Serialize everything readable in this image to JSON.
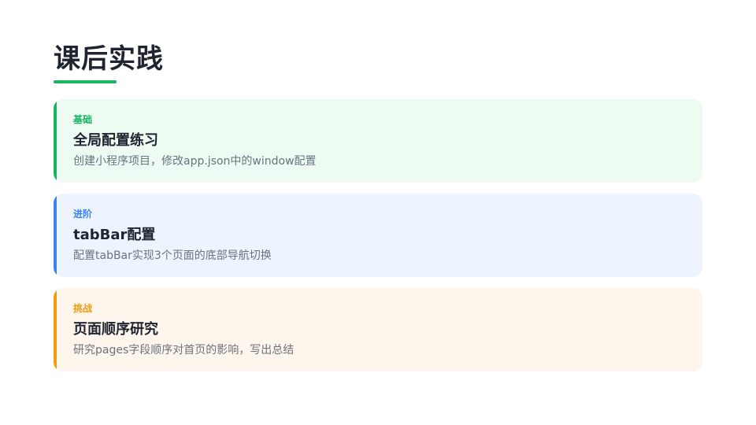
{
  "title": "课后实践",
  "colors": {
    "title_underline": "#18b45f"
  },
  "cards": [
    {
      "level": "基础",
      "title": "全局配置练习",
      "desc": "创建小程序项目，修改app.json中的window配置",
      "accent": "#18b45f",
      "background": "#edfbf2"
    },
    {
      "level": "进阶",
      "title": "tabBar配置",
      "desc": "配置tabBar实现3个页面的底部导航切换",
      "accent": "#3b82f6",
      "background": "#eef4fe"
    },
    {
      "level": "挑战",
      "title": "页面顺序研究",
      "desc": "研究pages字段顺序对首页的影响，写出总结",
      "accent": "#f39c12",
      "background": "#fef5ec"
    }
  ]
}
